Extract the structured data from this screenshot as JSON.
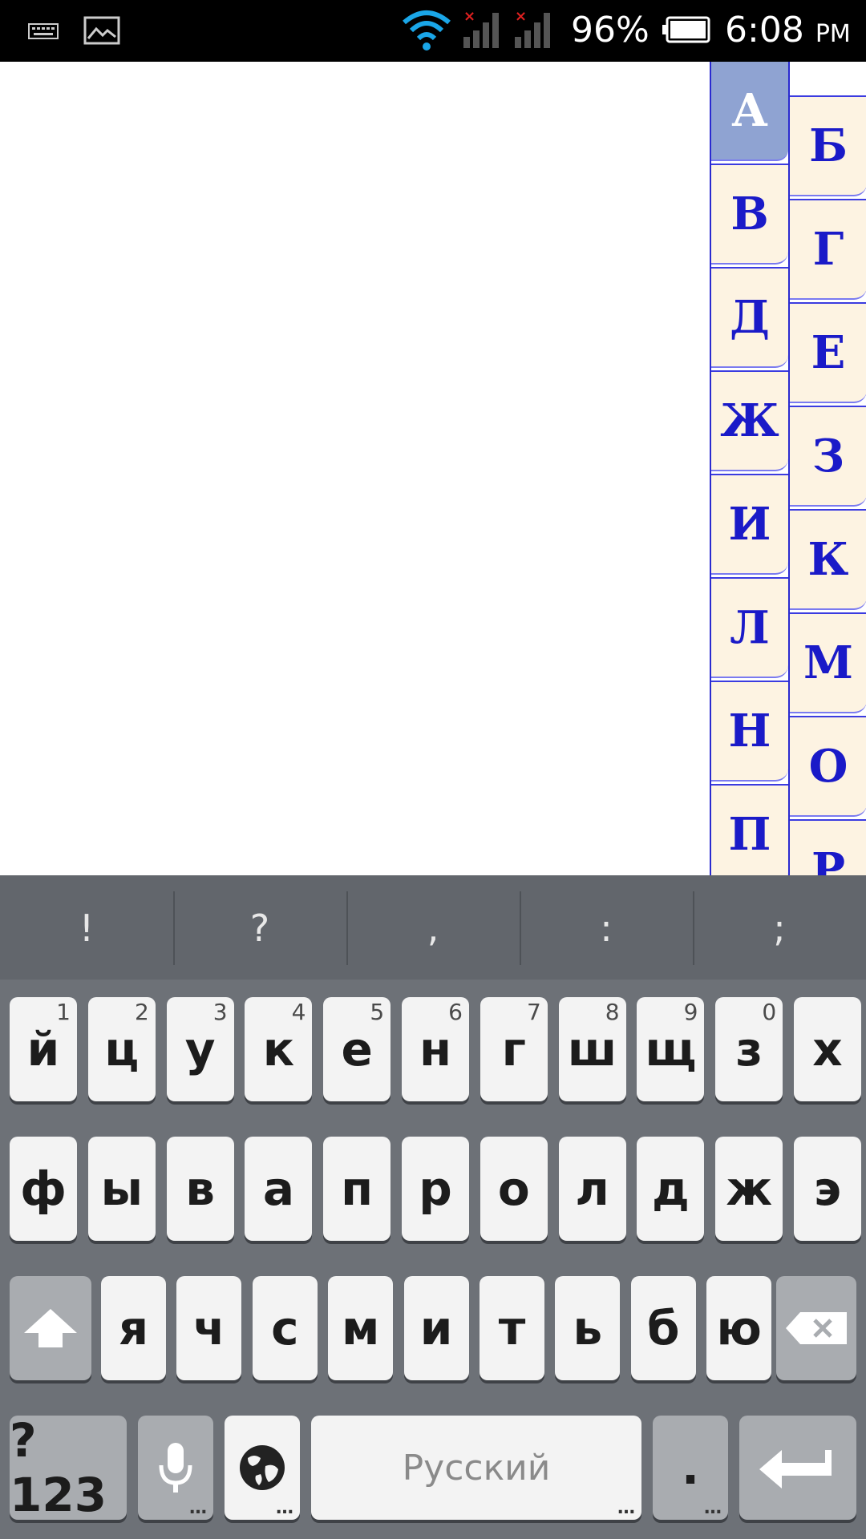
{
  "status_bar": {
    "battery_percent": "96%",
    "time": "6:08",
    "ampm": "PM",
    "icons": [
      "keyboard-icon",
      "picture-icon",
      "wifi-icon",
      "signal-no-service-icon",
      "signal-no-service-icon",
      "battery-icon"
    ]
  },
  "index": {
    "left_column": [
      "А",
      "В",
      "Д",
      "Ж",
      "И",
      "Л",
      "Н",
      "П"
    ],
    "right_column": [
      "Б",
      "Г",
      "Е",
      "З",
      "К",
      "М",
      "О",
      "Р"
    ],
    "active": "А",
    "colors": {
      "tab_bg": "#fdf3e2",
      "tab_active_bg": "#8fa3d2",
      "letter": "#1a1ac8",
      "border": "#2a2ad0"
    }
  },
  "keyboard": {
    "suggestions": [
      "!",
      "?",
      ",",
      ":",
      ";"
    ],
    "row1": [
      {
        "label": "й",
        "hint": "1"
      },
      {
        "label": "ц",
        "hint": "2"
      },
      {
        "label": "у",
        "hint": "3"
      },
      {
        "label": "к",
        "hint": "4"
      },
      {
        "label": "е",
        "hint": "5"
      },
      {
        "label": "н",
        "hint": "6"
      },
      {
        "label": "г",
        "hint": "7"
      },
      {
        "label": "ш",
        "hint": "8"
      },
      {
        "label": "щ",
        "hint": "9"
      },
      {
        "label": "з",
        "hint": "0"
      },
      {
        "label": "х",
        "hint": ""
      }
    ],
    "row2": [
      "ф",
      "ы",
      "в",
      "а",
      "п",
      "р",
      "о",
      "л",
      "д",
      "ж",
      "э"
    ],
    "row3": [
      "я",
      "ч",
      "с",
      "м",
      "и",
      "т",
      "ь",
      "б",
      "ю"
    ],
    "row4": {
      "symbols_label": "?123",
      "space_label": "Русский",
      "period_label": "."
    }
  }
}
